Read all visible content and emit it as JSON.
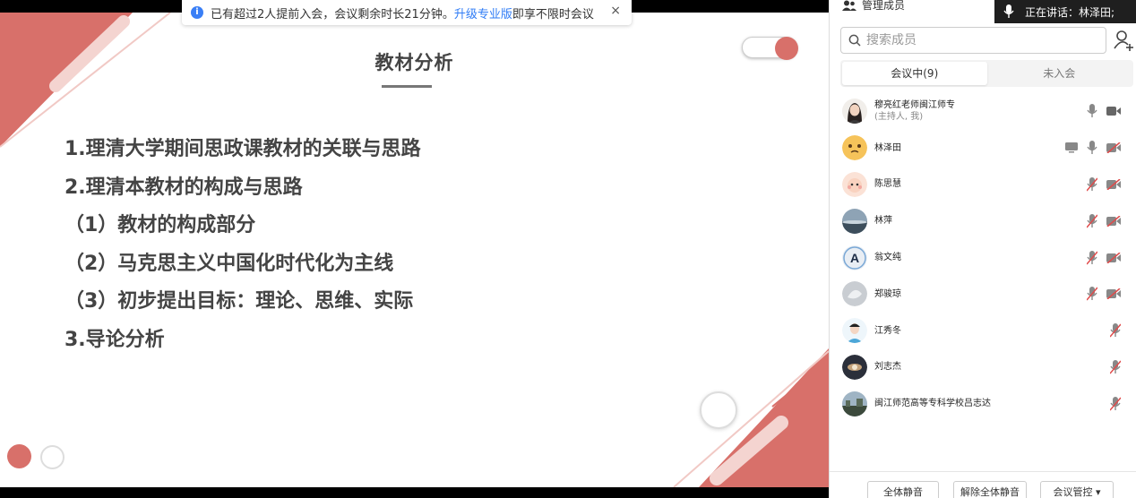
{
  "notice": {
    "text_before": "已有超过2人提前入会，会议剩余时长21分钟。",
    "link": "升级专业版",
    "text_after": "即享不限时会议",
    "close": "×"
  },
  "slide": {
    "title": "教材分析",
    "lines": [
      "1.理清大学期间思政课教材的关联与思路",
      "2.理清本教材的构成与思路",
      "（1）教材的构成部分",
      "（2）马克思主义中国化时代化为主线",
      "（3）初步提出目标：理论、思维、实际",
      "3.导论分析"
    ],
    "accent_color": "#d8706a"
  },
  "panel": {
    "manage_label": "管理成员",
    "speaking": "正在讲话：林泽田;",
    "search_placeholder": "搜索成员",
    "tabs": [
      "会议中(9)",
      "未入会"
    ],
    "members": [
      {
        "name": "穆亮红老师闽江师专",
        "sub": "(主持人, 我)"
      },
      {
        "name": "林泽田"
      },
      {
        "name": "陈思慧"
      },
      {
        "name": "林萍"
      },
      {
        "name": "翁文纯"
      },
      {
        "name": "郑骏琼"
      },
      {
        "name": "江秀冬"
      },
      {
        "name": "刘志杰"
      },
      {
        "name": "闽江师范高等专科学校吕志达"
      }
    ],
    "footer": {
      "mute_all": "全体静音",
      "unmute_all": "解除全体静音",
      "control": "会议管控 ▾"
    }
  }
}
